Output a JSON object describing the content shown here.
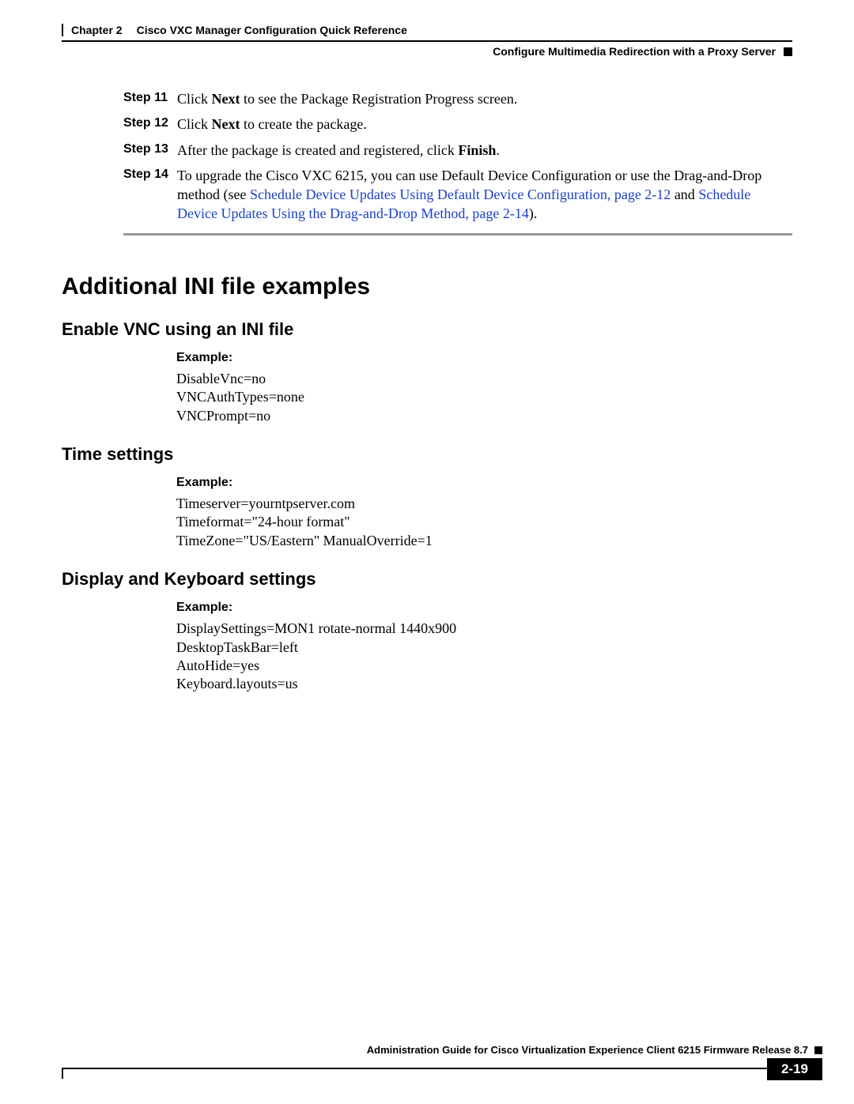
{
  "header": {
    "chapter_label": "Chapter 2",
    "chapter_title": "Cisco VXC Manager Configuration Quick Reference",
    "section_right": "Configure Multimedia Redirection with a Proxy Server"
  },
  "steps": [
    {
      "label": "Step 11",
      "parts": [
        {
          "t": "Click "
        },
        {
          "t": "Next",
          "bold": true
        },
        {
          "t": " to see the Package Registration Progress screen."
        }
      ]
    },
    {
      "label": "Step 12",
      "parts": [
        {
          "t": "Click "
        },
        {
          "t": "Next",
          "bold": true
        },
        {
          "t": " to create the package."
        }
      ]
    },
    {
      "label": "Step 13",
      "parts": [
        {
          "t": "After the package is created and registered, click "
        },
        {
          "t": "Finish",
          "bold": true
        },
        {
          "t": "."
        }
      ]
    },
    {
      "label": "Step 14",
      "parts": [
        {
          "t": "To upgrade the Cisco VXC 6215, you can use Default Device Configuration or use the Drag-and-Drop method (see "
        },
        {
          "t": "Schedule Device Updates Using Default Device Configuration, page 2-12",
          "link": true
        },
        {
          "t": " and "
        },
        {
          "t": "Schedule Device Updates Using the Drag-and-Drop Method, page 2-14",
          "link": true
        },
        {
          "t": ")."
        }
      ]
    }
  ],
  "main_heading": "Additional INI file examples",
  "subsections": [
    {
      "title": "Enable VNC using an INI file",
      "example_label": "Example:",
      "lines": [
        "DisableVnc=no",
        "VNCAuthTypes=none",
        "VNCPrompt=no"
      ]
    },
    {
      "title": "Time settings",
      "example_label": "Example:",
      "lines": [
        "Timeserver=yourntpserver.com",
        "Timeformat=\"24-hour format\"",
        "TimeZone=\"US/Eastern\" ManualOverride=1"
      ]
    },
    {
      "title": "Display and Keyboard settings",
      "example_label": "Example:",
      "lines": [
        "DisplaySettings=MON1 rotate-normal 1440x900",
        "DesktopTaskBar=left",
        "AutoHide=yes",
        "Keyboard.layouts=us"
      ]
    }
  ],
  "footer": {
    "guide": "Administration Guide for Cisco Virtualization Experience Client 6215 Firmware Release 8.7",
    "page": "2-19"
  }
}
